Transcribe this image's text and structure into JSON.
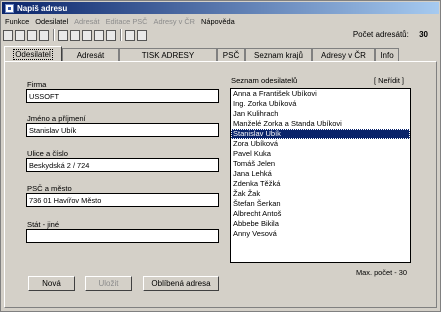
{
  "window": {
    "title": "Napiš adresu"
  },
  "menu": [
    {
      "label": "Funkce",
      "enabled": true
    },
    {
      "label": "Odesilatel",
      "enabled": true
    },
    {
      "label": "Adresát",
      "enabled": false
    },
    {
      "label": "Editace PSČ",
      "enabled": false
    },
    {
      "label": "Adresy v ČR",
      "enabled": false
    },
    {
      "label": "Nápověda",
      "enabled": true
    }
  ],
  "toolbar": {
    "icons": [
      "new-file-icon",
      "open-folder-icon",
      "list-icon",
      "delete-icon",
      "print-icon",
      "copy-icon",
      "paste-icon",
      "down-arrow-icon",
      "edit-icon",
      "export-icon",
      "key-icon"
    ]
  },
  "count": {
    "label": "Počet adresátů:",
    "value": "30"
  },
  "tabs": [
    {
      "label": "Odesilatel"
    },
    {
      "label": "Adresát"
    },
    {
      "label": "TISK ADRESY"
    },
    {
      "label": "PSČ"
    },
    {
      "label": "Seznam krajů"
    },
    {
      "label": "Adresy v ČR"
    },
    {
      "label": "Info"
    }
  ],
  "form": {
    "firma": {
      "label": "Firma",
      "value": "USSOFT"
    },
    "jmeno": {
      "label": "Jméno a příjmení",
      "value": "Stanislav Ubík"
    },
    "ulice": {
      "label": "Ulice a číslo",
      "value": "Beskydská 2 / 724"
    },
    "psc": {
      "label": "PSČ a město",
      "value": "736 01 Havířov Město"
    },
    "stat": {
      "label": "Stát - jiné",
      "value": ""
    }
  },
  "senders": {
    "label": "Seznam odesilatelů",
    "link": "[ Neřídit ]",
    "items": [
      "Anna a František Ubíkovi",
      "Ing. Zorka Ubíková",
      "Jan Kulihrach",
      "Manželé Zorka a Standa Ubíkovi",
      "Stanislav Ubík",
      "Zora Ubíková",
      "Pavel Kuka",
      "Tomáš Jelen",
      "Jana Lehká",
      "Zdenka Těžká",
      "Žak Žak",
      "Štefan Šerkan",
      "Albrecht Antoš",
      "Abbebe Bikila",
      "Anny Vesová"
    ],
    "selected_index": 4,
    "max_label": "Max. počet - 30"
  },
  "buttons": {
    "new": "Nová",
    "save": "Uložit",
    "favorite": "Oblíbená adresa"
  }
}
